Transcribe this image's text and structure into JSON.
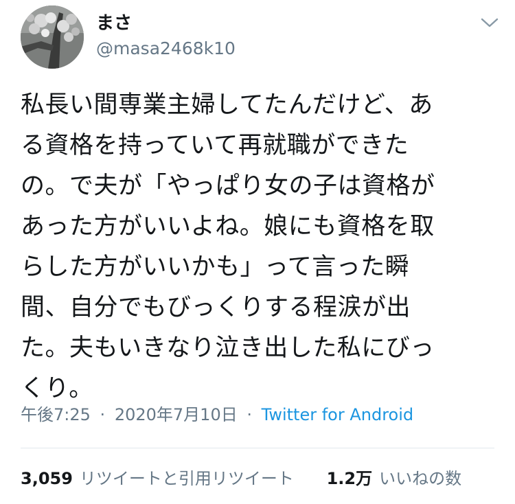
{
  "user": {
    "display_name": "まさ",
    "handle": "@masa2468k10"
  },
  "tweet": {
    "lines": [
      "私長い間専業主婦してたんだけど、あ",
      "る資格を持っていて再就職ができた",
      "の。で夫が「やっぱり女の子は資格が",
      "あった方がいいよね。娘にも資格を取",
      "らした方がいいかも」って言った瞬",
      "間、自分でもびっくりする程涙が出",
      "た。夫もいきなり泣き出した私にびっ",
      "くり。"
    ]
  },
  "meta": {
    "time": "午後7:25",
    "separator": "·",
    "date": "2020年7月10日",
    "source": "Twitter for Android"
  },
  "stats": {
    "retweets_count": "3,059",
    "retweets_label": "リツイートと引用リツイート",
    "likes_count": "1.2万",
    "likes_label": "いいねの数"
  },
  "icons": {
    "more": "chevron-down-icon",
    "avatar": "cherry-blossom-photo"
  },
  "colors": {
    "text": "#14171a",
    "secondary": "#657786",
    "link": "#1b95e0",
    "divider": "#e1e8ed"
  }
}
